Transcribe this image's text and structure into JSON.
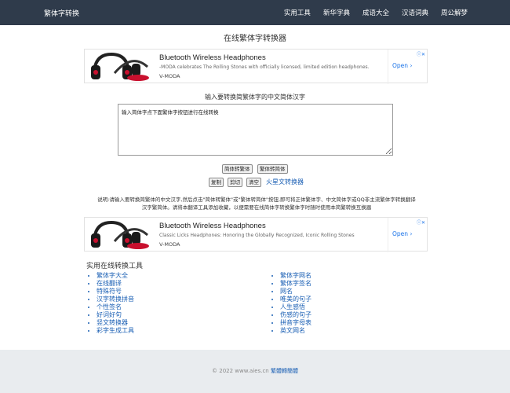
{
  "navbar": {
    "brand": "繁体字转换",
    "links": [
      "实用工具",
      "新华字典",
      "成语大全",
      "汉语词典",
      "周公解梦"
    ]
  },
  "page_title": "在线繁体字转换器",
  "ads": [
    {
      "title": "Bluetooth Wireless Headphones",
      "desc": "-MODA celebrates The Rolling Stones with officially licensed, limited edition headphones.",
      "brand": "V-MODA",
      "open": "Open"
    },
    {
      "title": "Bluetooth Wireless Headphones",
      "desc": "Classic Licks Headphones: Honoring the Globally Recognized, Iconic Rolling Stones",
      "brand": "V-MODA",
      "open": "Open"
    }
  ],
  "converter": {
    "label": "输入要转换简繁体字的中文简体汉字",
    "textarea_value": "输入简体字点下面繁体字按钮进行在线转换",
    "btn_to_trad": "简体转繁体",
    "btn_to_simp": "繁体转简体",
    "btn_copy": "复制",
    "btn_cut": "剪切",
    "btn_clear": "清空",
    "mars_link": "火星文转换器"
  },
  "description_line1": "说明:请输入要转换简繁体的中文汉字,然后点击\"简体转繁体\"或\"繁体转简体\"按钮,即可将正体繁体字、中文简体字或QQ非主流繁体字转换翻译",
  "description_line2": "汉字繁简体。请将本翻译工具添加收藏，以便需要在线简体字转换繁体字时随时使用本简繁转换互换器",
  "tools": {
    "title": "实用在线转换工具",
    "col1": [
      "繁体字大全",
      "在线翻译",
      "特殊符号",
      "汉字转换拼音",
      "个性签名",
      "好词好句",
      "竖文转换器",
      "彩字生成工具"
    ],
    "col2": [
      "繁体字网名",
      "繁体字签名",
      "网名",
      "唯美的句子",
      "人生感悟",
      "伤感的句子",
      "拼音字母表",
      "英文网名"
    ]
  },
  "footer": {
    "copyright": "© 2022 www.aies.cn",
    "link": "繁體轉簡體"
  }
}
